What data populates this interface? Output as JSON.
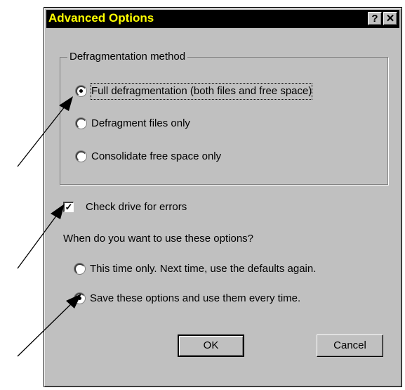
{
  "dialog": {
    "title": "Advanced Options",
    "help_button": "?",
    "close_button": "✕",
    "defrag_group": {
      "label": "Defragmentation method",
      "options": [
        {
          "label": "Full defragmentation (both files and free space)",
          "mnemonic": "F",
          "checked": true
        },
        {
          "label": "Defragment files only",
          "mnemonic": "D",
          "checked": false
        },
        {
          "label": "Consolidate free space only",
          "mnemonic": "C",
          "checked": false
        }
      ]
    },
    "check_errors": {
      "label": "Check drive for errors",
      "mnemonic": "e",
      "checked": true,
      "check_glyph": "✓"
    },
    "question": "When do you want to use these options?",
    "usage_options": [
      {
        "label": "This time only. Next time, use the defaults again.",
        "mnemonic": "T",
        "checked": false
      },
      {
        "label": "Save these options and use them every time.",
        "mnemonic": "S",
        "checked": true
      }
    ],
    "buttons": {
      "ok": "OK",
      "cancel": "Cancel"
    }
  }
}
